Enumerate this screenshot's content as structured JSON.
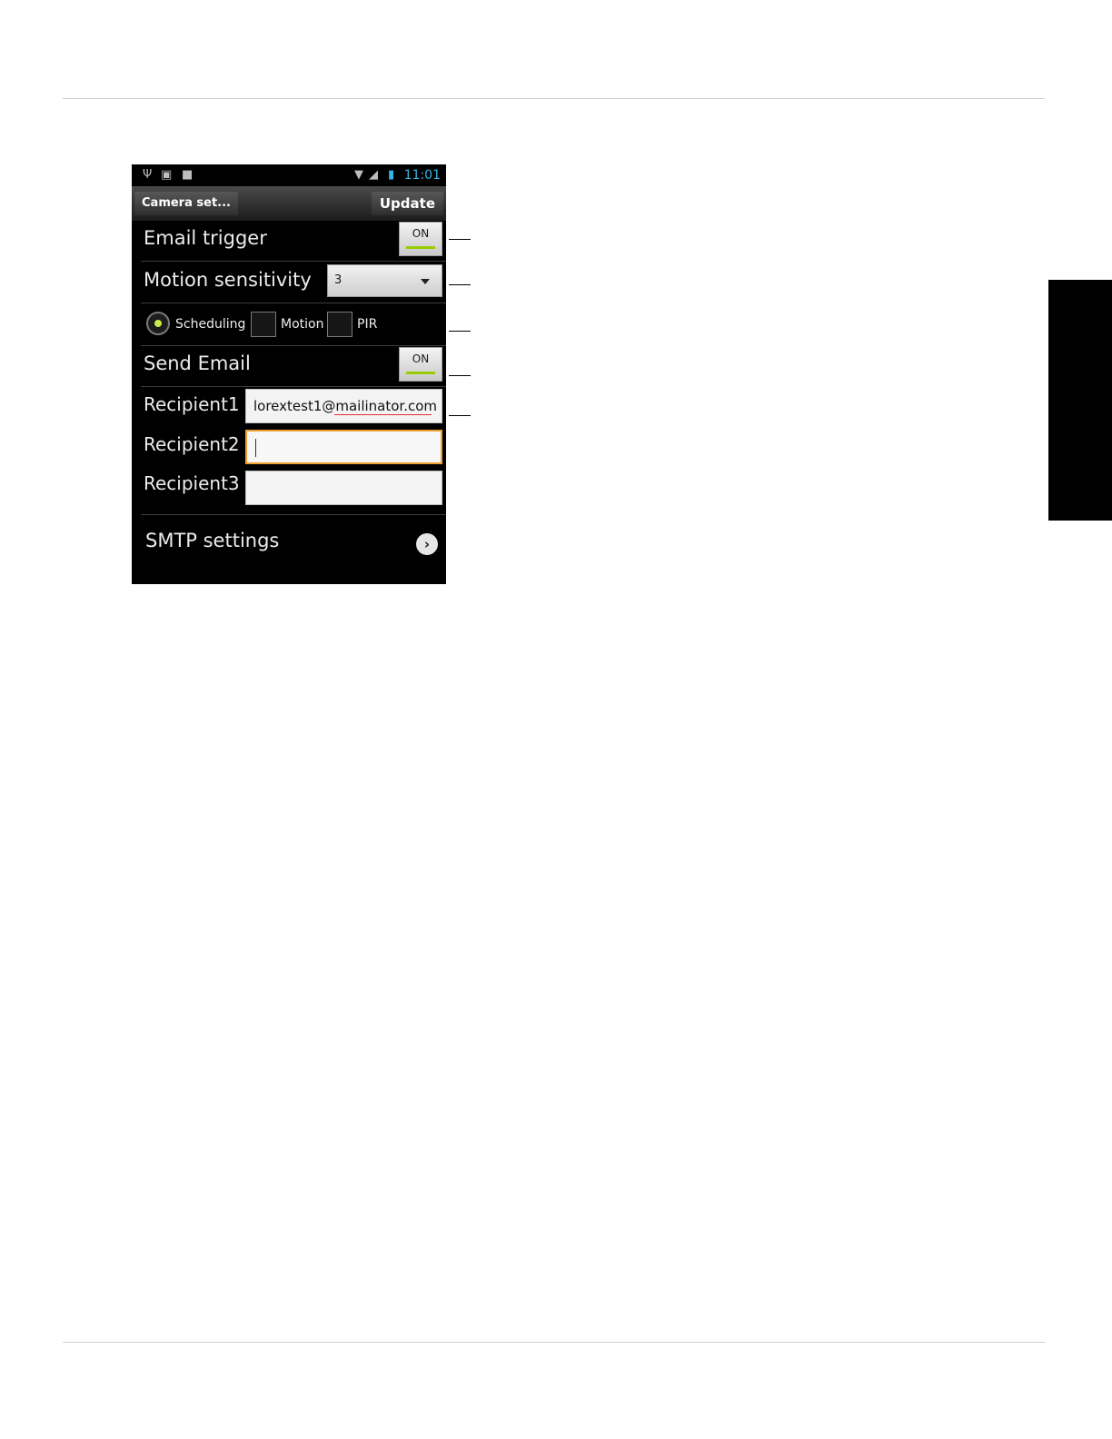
{
  "status_bar": {
    "time": "11:01",
    "icons": [
      "usb-icon",
      "image-icon",
      "briefcase-icon",
      "wifi-icon",
      "signal-icon",
      "battery-icon"
    ]
  },
  "action_bar": {
    "title": "Camera set...",
    "update_label": "Update"
  },
  "email_trigger": {
    "label": "Email trigger",
    "toggle": "ON"
  },
  "motion_sensitivity": {
    "label": "Motion sensitivity",
    "selected": "3"
  },
  "trigger_options": {
    "scheduling": "Scheduling",
    "motion": "Motion",
    "pir": "PIR",
    "scheduling_selected": true,
    "motion_checked": false,
    "pir_checked": false
  },
  "send_email": {
    "label": "Send Email",
    "toggle": "ON"
  },
  "recipients": [
    {
      "label": "Recipient1",
      "value": "lorextest1@mailinator.com"
    },
    {
      "label": "Recipient2",
      "value": ""
    },
    {
      "label": "Recipient3",
      "value": ""
    }
  ],
  "smtp": {
    "label": "SMTP settings"
  },
  "colors": {
    "accent_toggle": "#99cc00",
    "focus_border": "#f0a030",
    "clock": "#33b5e5"
  }
}
